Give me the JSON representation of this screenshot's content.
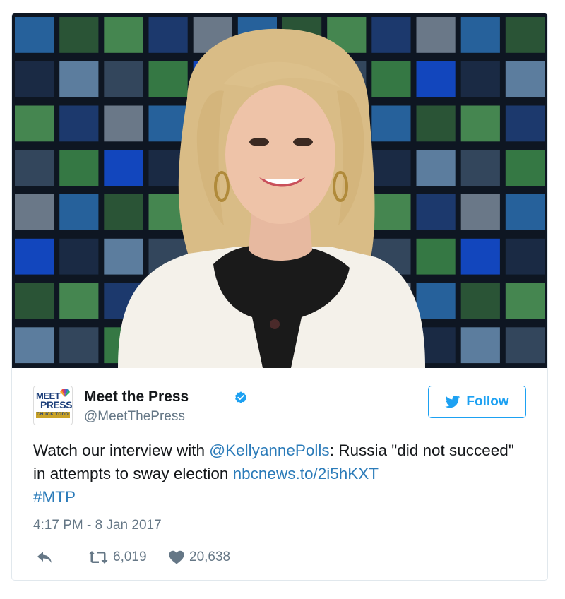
{
  "tweet": {
    "author": {
      "name": "Meet the Press",
      "handle": "@MeetThePress",
      "verified": true,
      "avatar_text": [
        "MEET",
        "PRESS",
        "CHUCK TODD"
      ]
    },
    "follow_label": "Follow",
    "text_parts": {
      "p1": "Watch our interview with ",
      "mention": "@KellyannePolls",
      "p2": ": Russia \"did not succeed\" in attempts to sway election ",
      "link": "nbcnews.to/2i5hKXT",
      "hashtag": "#MTP"
    },
    "timestamp": "4:17 PM - 8 Jan 2017",
    "retweets": "6,019",
    "likes": "20,638"
  },
  "colors": {
    "accent": "#1da1f2",
    "link": "#2b7bb9",
    "muted": "#657786",
    "text": "#14171a",
    "border": "#e1e8ed"
  },
  "icons": {
    "verified": "verified-badge-icon",
    "follow": "twitter-bird-icon",
    "reply": "reply-icon",
    "retweet": "retweet-icon",
    "like": "heart-icon"
  }
}
